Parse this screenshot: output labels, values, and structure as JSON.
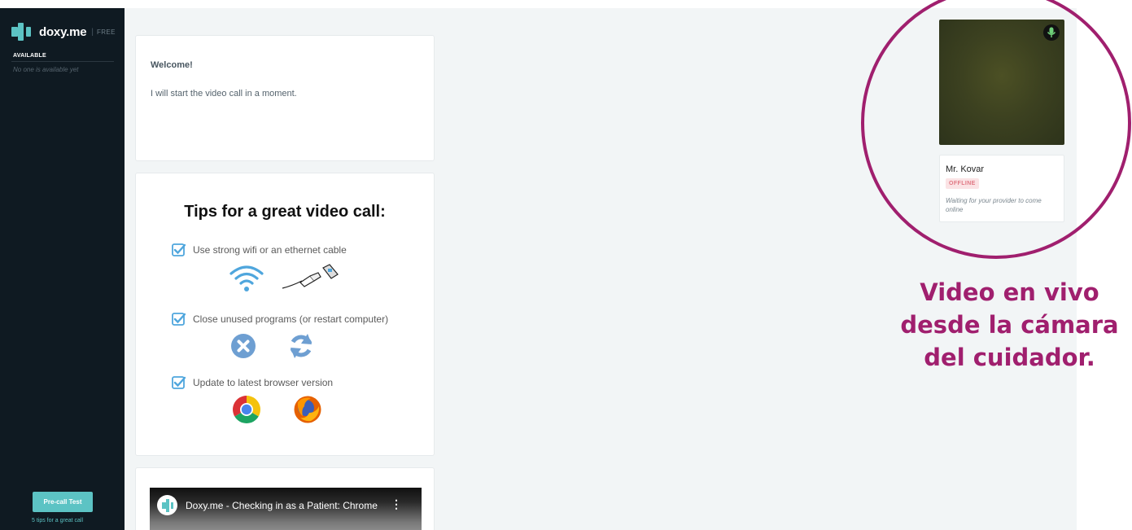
{
  "brand": {
    "name": "doxy.me",
    "tier": "FREE",
    "color": "#5cc3c4"
  },
  "sidebar": {
    "available_label": "AVAILABLE",
    "available_empty": "No one is available yet",
    "precall_button": "Pre-call Test",
    "tips_link": "5 tips for a great call"
  },
  "welcome": {
    "title": "Welcome!",
    "message": "I will start the video call in a moment."
  },
  "tips": {
    "title": "Tips for a great video call:",
    "items": [
      {
        "label": "Use strong wifi or an ethernet cable",
        "icons": [
          "wifi-icon",
          "ethernet-cable-icon"
        ]
      },
      {
        "label": "Close unused programs (or restart computer)",
        "icons": [
          "close-x-icon",
          "refresh-icon"
        ]
      },
      {
        "label": "Update to latest browser version",
        "icons": [
          "chrome-icon",
          "firefox-icon"
        ]
      }
    ]
  },
  "video": {
    "title": "Doxy.me - Checking in as a Patient: Chrome",
    "menu": "⋮"
  },
  "provider": {
    "name": "Mr. Kovar",
    "status": "OFFLINE",
    "waiting": "Waiting for your provider to come online"
  },
  "annotation": {
    "lines": [
      "Video en vivo",
      "desde la cámara",
      "del cuidador."
    ],
    "color": "#a01f6e"
  }
}
